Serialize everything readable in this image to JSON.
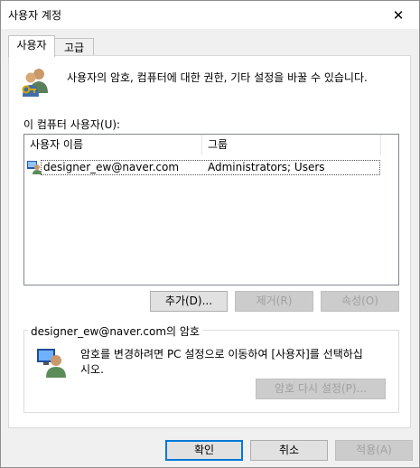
{
  "window": {
    "title": "사용자 계정",
    "close_glyph": "✕"
  },
  "tabs": [
    {
      "label": "사용자",
      "active": true
    },
    {
      "label": "고급",
      "active": false
    }
  ],
  "intro": {
    "text": "사용자의 암호, 컴퓨터에 대한 권한, 기타 설정을 바꿀 수 있습니다."
  },
  "users_section": {
    "label": "이 컴퓨터 사용자(U):",
    "columns": [
      "사용자 이름",
      "그룹"
    ],
    "rows": [
      {
        "username": "designer_ew@naver.com",
        "group": "Administrators; Users"
      }
    ]
  },
  "list_buttons": {
    "add": "추가(D)...",
    "remove": "제거(R)",
    "properties": "속성(O)"
  },
  "password_group": {
    "title": "designer_ew@naver.com의 암호",
    "message": "암호를 변경하려면 PC 설정으로 이동하여 [사용자]를 선택하십\n시오.",
    "reset_button": "암호 다시 설정(P)..."
  },
  "dialog_buttons": {
    "ok": "확인",
    "cancel": "취소",
    "apply": "적용(A)"
  },
  "colors": {
    "accent": "#0078d7",
    "disabled_text": "#a0a0a0"
  }
}
